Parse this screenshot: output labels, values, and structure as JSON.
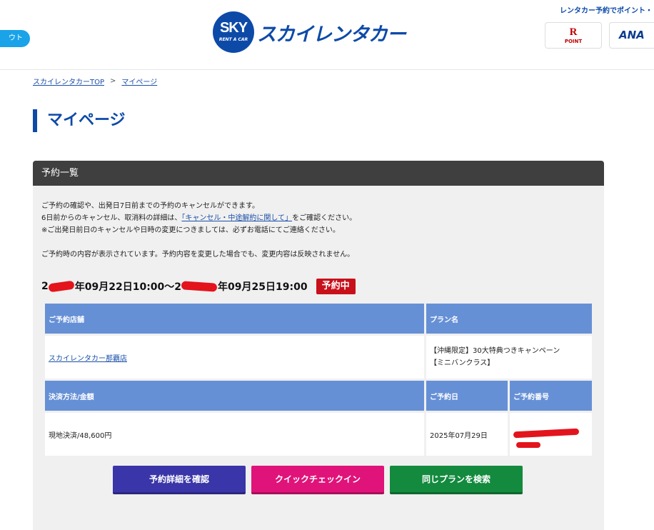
{
  "header": {
    "logout_label": "ウト",
    "logo_mark": "SKY",
    "logo_sub": "RENT A CAR",
    "logo_text": "スカイレンタカー",
    "promo_text": "レンタカー予約でポイント・",
    "rakuten_mark": "R",
    "rakuten_label": "POINT",
    "ana_label": "ANA"
  },
  "breadcrumb": {
    "home": "スカイレンタカーTOP",
    "separator": ">",
    "current": "マイページ"
  },
  "page_title": "マイページ",
  "panel": {
    "title": "予約一覧",
    "notes": {
      "line1": "ご予約の確認や、出発日7日前までの予約のキャンセルができます。",
      "line2_pre": "6日前からのキャンセル、取消料の詳細は、",
      "line2_link": "「キャンセル・中途解約に関して」",
      "line2_post": "をご確認ください。",
      "line3": "※ご出発日前日のキャンセルや日時の変更につきましては、必ずお電話にてご連絡ください。",
      "line4": "ご予約時の内容が表示されています。予約内容を変更した場合でも、変更内容は反映されません。"
    },
    "reservation": {
      "start_prefix": "2",
      "start": "年09月22日10:00～2",
      "end": "年09月25日19:00",
      "status": "予約中",
      "headers": {
        "store": "ご予約店舗",
        "plan": "プラン名",
        "payment": "決済方法/金額",
        "date": "ご予約日",
        "number": "ご予約番号"
      },
      "store": "スカイレンタカー那覇店",
      "plan_line1": "【沖縄限定】30大特典つきキャンペーン",
      "plan_line2": "【ミニバンクラス】",
      "payment": "現地決済/48,600円",
      "reserved_date": "2025年07月29日"
    },
    "buttons": {
      "detail": "予約詳細を確認",
      "checkin": "クイックチェックイン",
      "search": "同じプランを検索"
    }
  }
}
